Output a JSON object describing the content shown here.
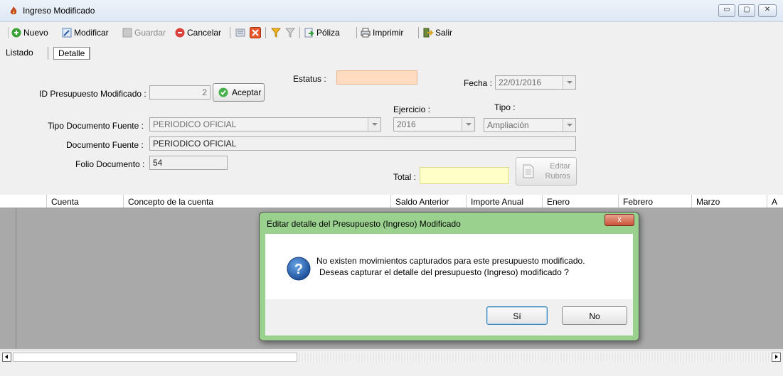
{
  "window": {
    "title": "Ingreso Modificado",
    "controls": {
      "minimize": "▭",
      "maximize": "▢",
      "close": "✕"
    }
  },
  "toolbar": {
    "nuevo": "Nuevo",
    "modificar": "Modificar",
    "guardar": "Guardar",
    "cancelar": "Cancelar",
    "poliza": "Póliza",
    "imprimir": "Imprimir",
    "salir": "Salir"
  },
  "tabs": {
    "listado": "Listado",
    "detalle": "Detalle"
  },
  "form": {
    "estatus_label": "Estatus :",
    "estatus_value": "",
    "fecha_label": "Fecha :",
    "fecha_value": "22/01/2016",
    "id_label": "ID Presupuesto Modificado :",
    "id_value": "2",
    "aceptar": "Aceptar",
    "ejercicio_label": "Ejercicio :",
    "ejercicio_value": "2016",
    "tipo_label": "Tipo :",
    "tipo_value": "Ampliación",
    "tipo_doc_label": "Tipo Documento Fuente :",
    "tipo_doc_value": "PERIODICO OFICIAL",
    "doc_fuente_label": "Documento Fuente :",
    "doc_fuente_value": "PERIODICO OFICIAL",
    "folio_label": "Folio Documento :",
    "folio_value": "54",
    "total_label": "Total :",
    "total_value": "",
    "editar_line1": "Editar",
    "editar_line2": "Rubros"
  },
  "grid": {
    "columns": [
      "Cuenta",
      "Concepto de la cuenta",
      "Saldo Anterior",
      "Importe Anual",
      "Enero",
      "Febrero",
      "Marzo",
      "A"
    ]
  },
  "dialog": {
    "title": "Editar detalle del Presupuesto (Ingreso) Modificado",
    "close": "x",
    "message_line1": "No existen movimientos capturados para este presupuesto modificado.",
    "message_line2": "Deseas capturar el detalle del presupuesto (Ingreso) modificado ?",
    "yes": "Sí",
    "no": "No"
  },
  "colors": {
    "estatus_bg": "#ffdcc0",
    "total_bg": "#ffffc8",
    "dialog_frame": "#9bd18f"
  }
}
